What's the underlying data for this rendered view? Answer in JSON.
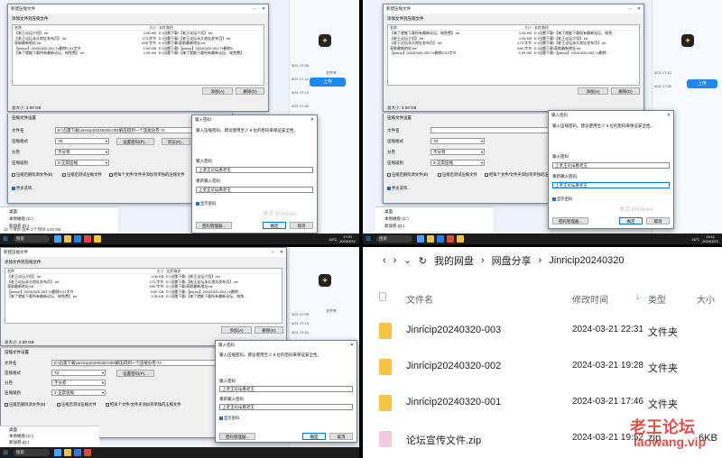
{
  "dlg_title": "新建压缩文件",
  "add_files_title": "添加文件到压缩文件",
  "cols": {
    "name": "名称",
    "size": "大小",
    "path": "文件路径"
  },
  "files_q1": [
    {
      "name": "【老王论坛介绍】.txt",
      "size": "1.06 KB",
      "path": "E:\\迅雷下载\\【老王论坛介绍】.txt"
    },
    {
      "name": "【老王论坛永久地址发布页】.txt",
      "size": "173 字节",
      "path": "E:\\迅雷下载\\【老王论坛永久地址发布页】.txt"
    },
    {
      "name": "获取最新地址.txt",
      "size": "599 字节",
      "path": "E:\\迅雷下载\\获取最新地址.txt"
    },
    {
      "name": "【jinricp】20240320-001.7z删除0.01字节",
      "size": "3.00 GB",
      "path": "E:\\迅雷下载\\【jinricp】20240320-001.7z删除0..."
    },
    {
      "name": "【来了就能下载所有最新论坛、纯免费】.txt",
      "size": "1.05 KB",
      "path": "E:\\迅雷下载\\【来了就能下载所有最新论坛、纯免费】..."
    }
  ],
  "files_q2": [
    {
      "name": "【来了就能下载所有最新论坛、纯免费】.txt",
      "size": "1.05 KB",
      "path": "E:\\迅雷下载\\【来了就能下载所有最新论坛、纯免..."
    },
    {
      "name": "【老王论坛介绍】.txt",
      "size": "1.06 KB",
      "path": "E:\\迅雷下载\\【老王论坛介绍】.txt"
    },
    {
      "name": "【老王论坛永久地址发布页】.txt",
      "size": "173 字节",
      "path": "E:\\迅雷下载\\【老王论坛永久地址发布页】.txt"
    },
    {
      "name": "获取最新地址.txt",
      "size": "599 字节",
      "path": "E:\\迅雷下载\\获取最新地址.txt"
    },
    {
      "name": "【jinricp】20240320-002.7z删除0.01字节",
      "size": "3.00 GB",
      "path": "E:\\迅雷下载\\【jinricp】20240320-002.7z删除..."
    }
  ],
  "files_q3": [
    {
      "name": "【老王论坛介绍】.txt",
      "size": "1.06 KB",
      "path": "E:\\迅雷下载\\【老王论坛介绍】.txt"
    },
    {
      "name": "【老王论坛永久地址发布页】.txt",
      "size": "173 字节",
      "path": "E:\\迅雷下载\\【老王论坛永久地址发布页】.txt"
    },
    {
      "name": "获取最新地址.txt",
      "size": "599 字节",
      "path": "E:\\迅雷下载\\获取最新地址.txt"
    },
    {
      "name": "【jinricp】20240320-003.7z删除0.01字节",
      "size": "3.00 GB",
      "path": "E:\\迅雷下载\\【jinricp】20240320-003.7z删除..."
    },
    {
      "name": "【来了就能下载所有最新论坛、纯免费】.txt",
      "size": "1.05 KB",
      "path": "E:\\迅雷下载\\【来了就能下载所有最新论坛、纯免..."
    }
  ],
  "add_btn": "添加(A)",
  "del_btn": "删除(D)",
  "total": "总大小: 3.00 GB",
  "settings_title": "压缩文件设置",
  "filename_label": "文件名",
  "filename_q1": "E:\\迅雷下载\\Jinricip20240320-001解压得到一个压缩分卷.7z",
  "filename_q3": "E:\\迅雷下载\\Jinricip20240320-003解压得到一个压缩分卷.7z",
  "format_label": "压缩格式",
  "format_val": "7Z",
  "volume_label": "分卷",
  "volume_val": "不分卷",
  "level_label": "压缩级别",
  "level_val": "2-正常压缩",
  "update_label": "更新方式",
  "update_val": "添加并替换文件",
  "setpwd_btn": "设置密码(P)...",
  "browse_btn": "浏览(R)...",
  "chk_delete": "压缩后删除源文件(D)",
  "chk_test": "压缩后测试压缩文件",
  "chk_each": "把每个文件/文件夹添加到单独的压缩文件",
  "more": "更多选项...",
  "pwd_title": "输入密码",
  "pwd_desc": "输入压缩密码。建议使用至少 8 位的密码来保证安全性。",
  "pwd_label": "输入密码",
  "pwd_confirm": "重新输入密码",
  "pwd_val": "上老王论坛看老王",
  "show_pwd": "显示密码",
  "manage_btn": "密码管理器...",
  "ok_btn": "确定",
  "cancel_btn": "取消",
  "activate": "激活 Windows",
  "times": [
    "3/21 17:09",
    "3/21 17:12",
    "3/21 17:13",
    "3/21 17:20",
    "3/21 17:22",
    "3/21 17:24"
  ],
  "side_lbl": "文件夹",
  "upload": "上传",
  "tree": [
    "桌面",
    "本地磁盘 (C:)",
    "新加卷 (D:)"
  ],
  "status_q1": "12 个项目   选中 1 个项目 3.00 GB",
  "status_q3": "12 个项目   选中 1 个项目 3.00 GB",
  "search": "搜索",
  "weather": "15°C",
  "time_q1": "17:21",
  "date_q1": "2024/3/21",
  "time_q2": "19:11",
  "date_q2": "2024/3/21",
  "q4": {
    "crumbs": [
      "我的网盘",
      "网盘分享",
      "Jinricip20240320"
    ],
    "h_name": "文件名",
    "h_time": "修改时间",
    "h_type": "类型",
    "h_size": "大小",
    "rows": [
      {
        "name": "Jinricip20240320-003",
        "time": "2024-03-21 22:31",
        "type": "文件夹",
        "size": ""
      },
      {
        "name": "Jinricip20240320-002",
        "time": "2024-03-21 19:28",
        "type": "文件夹",
        "size": ""
      },
      {
        "name": "Jinricip20240320-001",
        "time": "2024-03-21 17:46",
        "type": "文件夹",
        "size": ""
      },
      {
        "name": "论坛宣传文件.zip",
        "time": "2024-03-21 19:52",
        "type": "zip",
        "size": "6KB"
      }
    ],
    "wm1": "老王论坛",
    "wm2": "laowang.vip"
  }
}
